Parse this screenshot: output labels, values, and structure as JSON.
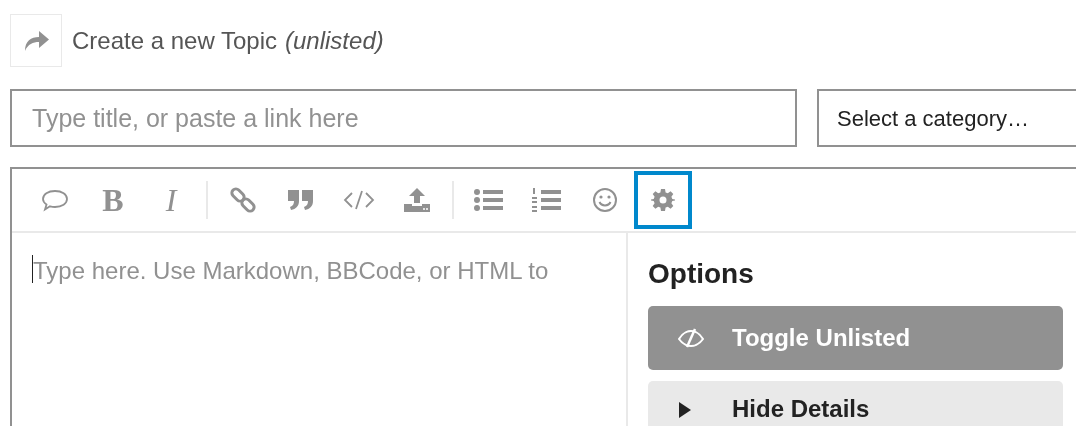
{
  "header": {
    "title": "Create a new Topic",
    "subtitle": "(unlisted)"
  },
  "title_field": {
    "placeholder": "Type title, or paste a link here"
  },
  "category_select": {
    "value": "Select a category…"
  },
  "toolbar": [
    [
      {
        "kind": "quote-bubble",
        "selected": false
      },
      {
        "kind": "bold",
        "label": "B",
        "selected": false
      },
      {
        "kind": "italic",
        "label": "I",
        "selected": false
      }
    ],
    [
      {
        "kind": "link",
        "selected": false
      },
      {
        "kind": "blockquote",
        "selected": false
      },
      {
        "kind": "code",
        "selected": false
      },
      {
        "kind": "upload",
        "selected": false
      }
    ],
    [
      {
        "kind": "bullet-list",
        "selected": false
      },
      {
        "kind": "numbered-list",
        "selected": false
      },
      {
        "kind": "emoji",
        "selected": false
      },
      {
        "kind": "options",
        "selected": true
      }
    ]
  ],
  "editor": {
    "placeholder": "Type here. Use Markdown, BBCode, or HTML to"
  },
  "options_panel": {
    "title": "Options",
    "items": [
      {
        "kind": "toggle-unlisted",
        "label": "Toggle Unlisted",
        "selected": true
      },
      {
        "kind": "hide-details",
        "label": "Hide Details",
        "selected": false
      }
    ]
  }
}
